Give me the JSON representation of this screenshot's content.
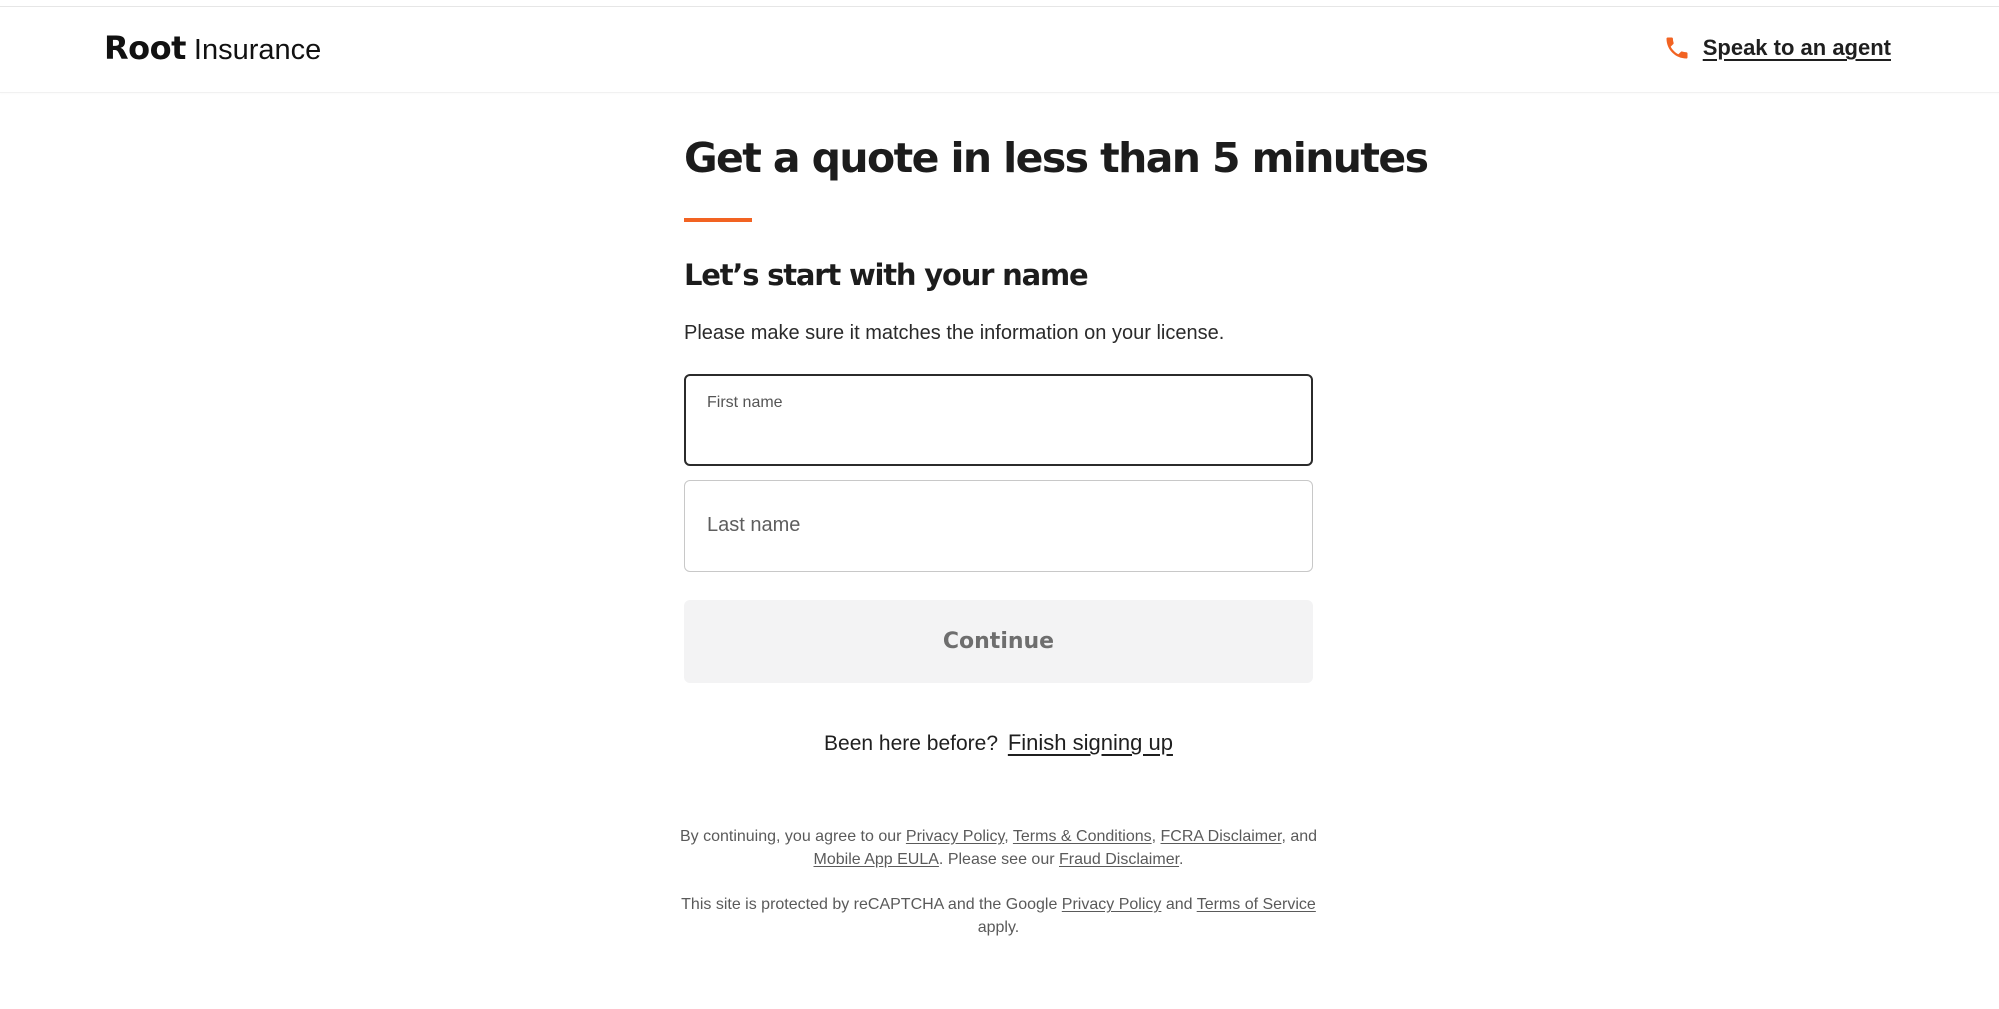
{
  "header": {
    "logo_brand": "Root",
    "logo_product": "Insurance",
    "agent_link_label": "Speak to an agent",
    "agent_icon": "phone-icon"
  },
  "colors": {
    "accent": "#f26322",
    "button_disabled_bg": "#f3f3f4",
    "button_disabled_text": "#6e6e6e",
    "text_primary": "#1c1c1c"
  },
  "main": {
    "headline": "Get a quote in less than 5 minutes",
    "subheadline": "Let’s start with your name",
    "helper_text": "Please make sure it matches the information on your license.",
    "first_name": {
      "label": "First name",
      "value": ""
    },
    "last_name": {
      "label": "Last name",
      "value": ""
    },
    "continue_label": "Continue",
    "been_here_text": "Been here before?",
    "finish_link": "Finish signing up"
  },
  "legal": {
    "line1_prefix": "By continuing, you agree to our",
    "privacy_policy": "Privacy Policy",
    "sep1": ",",
    "terms": "Terms & Conditions",
    "sep2": ",",
    "fcra": "FCRA Disclaimer",
    "sep3": ", and",
    "eula": "Mobile App EULA",
    "mid": ". Please see our",
    "fraud": "Fraud Disclaimer",
    "end": ".",
    "recaptcha_prefix": "This site is protected by reCAPTCHA and the Google",
    "google_privacy": "Privacy Policy",
    "and": "and",
    "google_terms": "Terms of Service",
    "apply": "apply."
  }
}
